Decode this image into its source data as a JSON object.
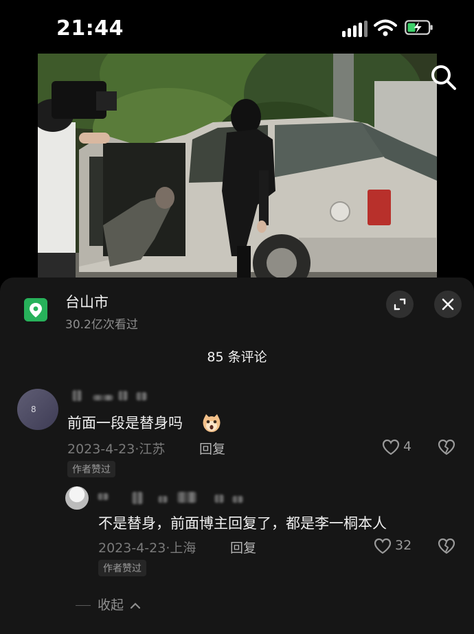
{
  "status_bar": {
    "time": "21:44"
  },
  "location": {
    "title": "台山市",
    "views": "30.2亿次看过"
  },
  "comments": {
    "count_label": "85 条评论",
    "items": [
      {
        "avatar_text": "8",
        "text": "前面一段是替身吗",
        "date": "2023-4-23",
        "region": "江苏",
        "reply_label": "回复",
        "likes": "4",
        "badge": "作者赞过",
        "replies": [
          {
            "text": "不是替身，前面博主回复了，都是李一桐本人",
            "date": "2023-4-23",
            "region": "上海",
            "reply_label": "回复",
            "likes": "32",
            "badge": "作者赞过"
          }
        ]
      }
    ],
    "collapse_label": "收起"
  },
  "icons": {
    "search": "search-icon",
    "location": "location-pin-icon",
    "expand": "expand-icon",
    "close": "close-icon",
    "like": "heart-icon",
    "dislike": "broken-heart-icon",
    "emoji": "surprised-cat-emoji-icon"
  },
  "colors": {
    "sheet_bg": "#161616",
    "location_green": "#27b15a"
  }
}
